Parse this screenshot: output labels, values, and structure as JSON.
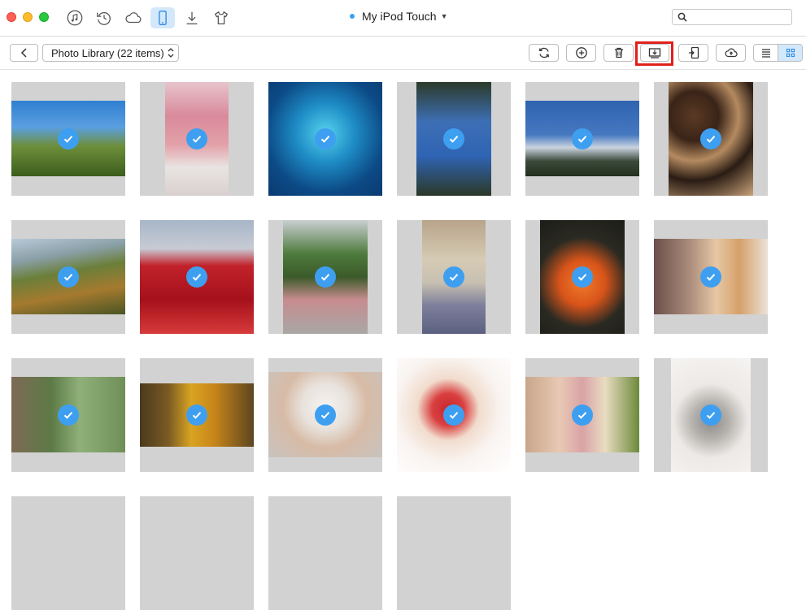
{
  "window": {
    "device_name": "My iPod Touch",
    "nav_icons": [
      "music-icon",
      "history-icon",
      "cloud-icon",
      "device-icon",
      "download-icon",
      "tshirt-icon"
    ],
    "active_nav": "device-icon"
  },
  "search": {
    "placeholder": "",
    "value": ""
  },
  "toolbar": {
    "album_label": "Photo Library (22 items)",
    "buttons": [
      "refresh-button",
      "add-button",
      "delete-button",
      "export-to-computer-button",
      "send-to-device-button",
      "upload-to-cloud-button"
    ],
    "highlighted_button": "export-to-computer-button",
    "view_mode": "grid"
  },
  "colors": {
    "accent": "#3e9ff0",
    "selected_bg": "#d4e8fb",
    "highlight_box": "#e0201b",
    "tile_bg": "#d2d2d2"
  },
  "photos": [
    {
      "subject": "pine trees under blue sky",
      "selected": true
    },
    {
      "subject": "pink cupcake roses",
      "selected": true
    },
    {
      "subject": "blue butterfly over water",
      "selected": true
    },
    {
      "subject": "tall trees against sky",
      "selected": true
    },
    {
      "subject": "snowy mountains at dusk",
      "selected": true
    },
    {
      "subject": "dinner table dishes",
      "selected": true
    },
    {
      "subject": "autumn hillside forest",
      "selected": true
    },
    {
      "subject": "red heart-shaped tree",
      "selected": true
    },
    {
      "subject": "office desk with plant",
      "selected": true
    },
    {
      "subject": "person in flower field",
      "selected": true
    },
    {
      "subject": "orange lily flowers",
      "selected": true
    },
    {
      "subject": "smiling child with flowers",
      "selected": true
    },
    {
      "subject": "toddler on path",
      "selected": true
    },
    {
      "subject": "girl with autumn leaves",
      "selected": true
    },
    {
      "subject": "baby in bear hat",
      "selected": true
    },
    {
      "subject": "baby in santa hat",
      "selected": true
    },
    {
      "subject": "baby with puppy",
      "selected": true
    },
    {
      "subject": "grey rabbit",
      "selected": true
    }
  ]
}
